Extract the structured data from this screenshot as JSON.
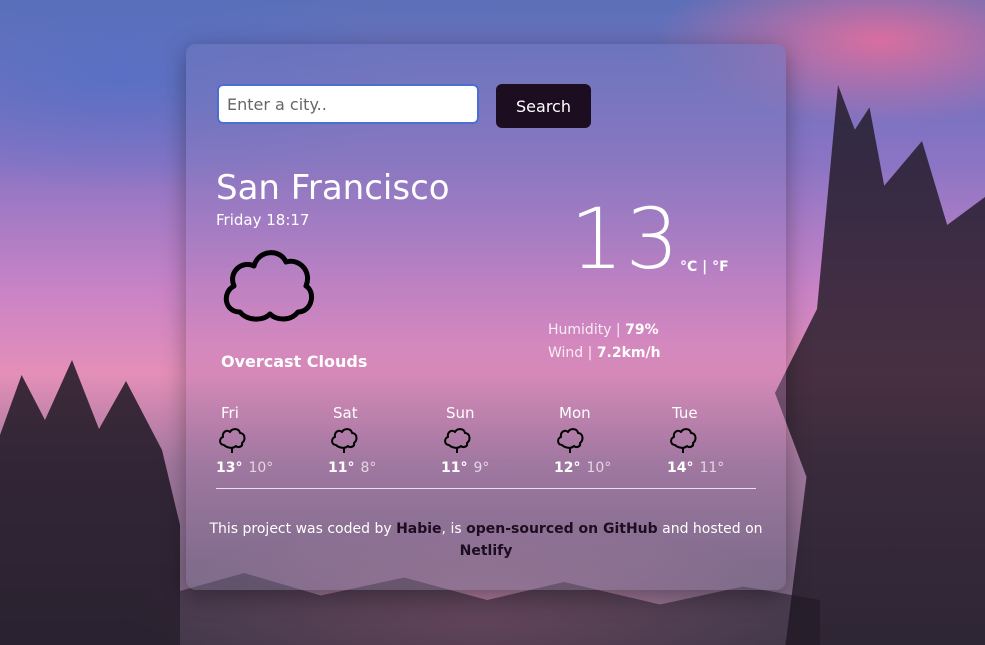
{
  "search": {
    "placeholder": "Enter a city..",
    "button_label": "Search"
  },
  "current": {
    "city": "San Francisco",
    "datetime": "Friday 18:17",
    "description": "Overcast Clouds",
    "temperature": "13",
    "unit_c": "°C",
    "unit_sep": " | ",
    "unit_f": "°F",
    "humidity_label": "Humidity | ",
    "humidity_value": "79%",
    "wind_label": "Wind | ",
    "wind_value": "7.2km/h",
    "icon": "cloud-icon"
  },
  "forecast": [
    {
      "day": "Fri",
      "max": "13°",
      "min": "10°",
      "icon": "cloud-icon"
    },
    {
      "day": "Sat",
      "max": "11°",
      "min": "8°",
      "icon": "cloud-icon"
    },
    {
      "day": "Sun",
      "max": "11°",
      "min": "9°",
      "icon": "cloud-icon"
    },
    {
      "day": "Mon",
      "max": "12°",
      "min": "10°",
      "icon": "cloud-icon"
    },
    {
      "day": "Tue",
      "max": "14°",
      "min": "11°",
      "icon": "cloud-icon"
    }
  ],
  "footer": {
    "text_1": "This project was coded by ",
    "link_author": "Habie",
    "text_2": ", is ",
    "link_github": "open-sourced on GitHub",
    "text_3": " and hosted on ",
    "link_host": "Netlify"
  },
  "colors": {
    "button_bg": "#1c0d20",
    "link": "#1c0d20",
    "input_border": "#4a6fd0"
  }
}
